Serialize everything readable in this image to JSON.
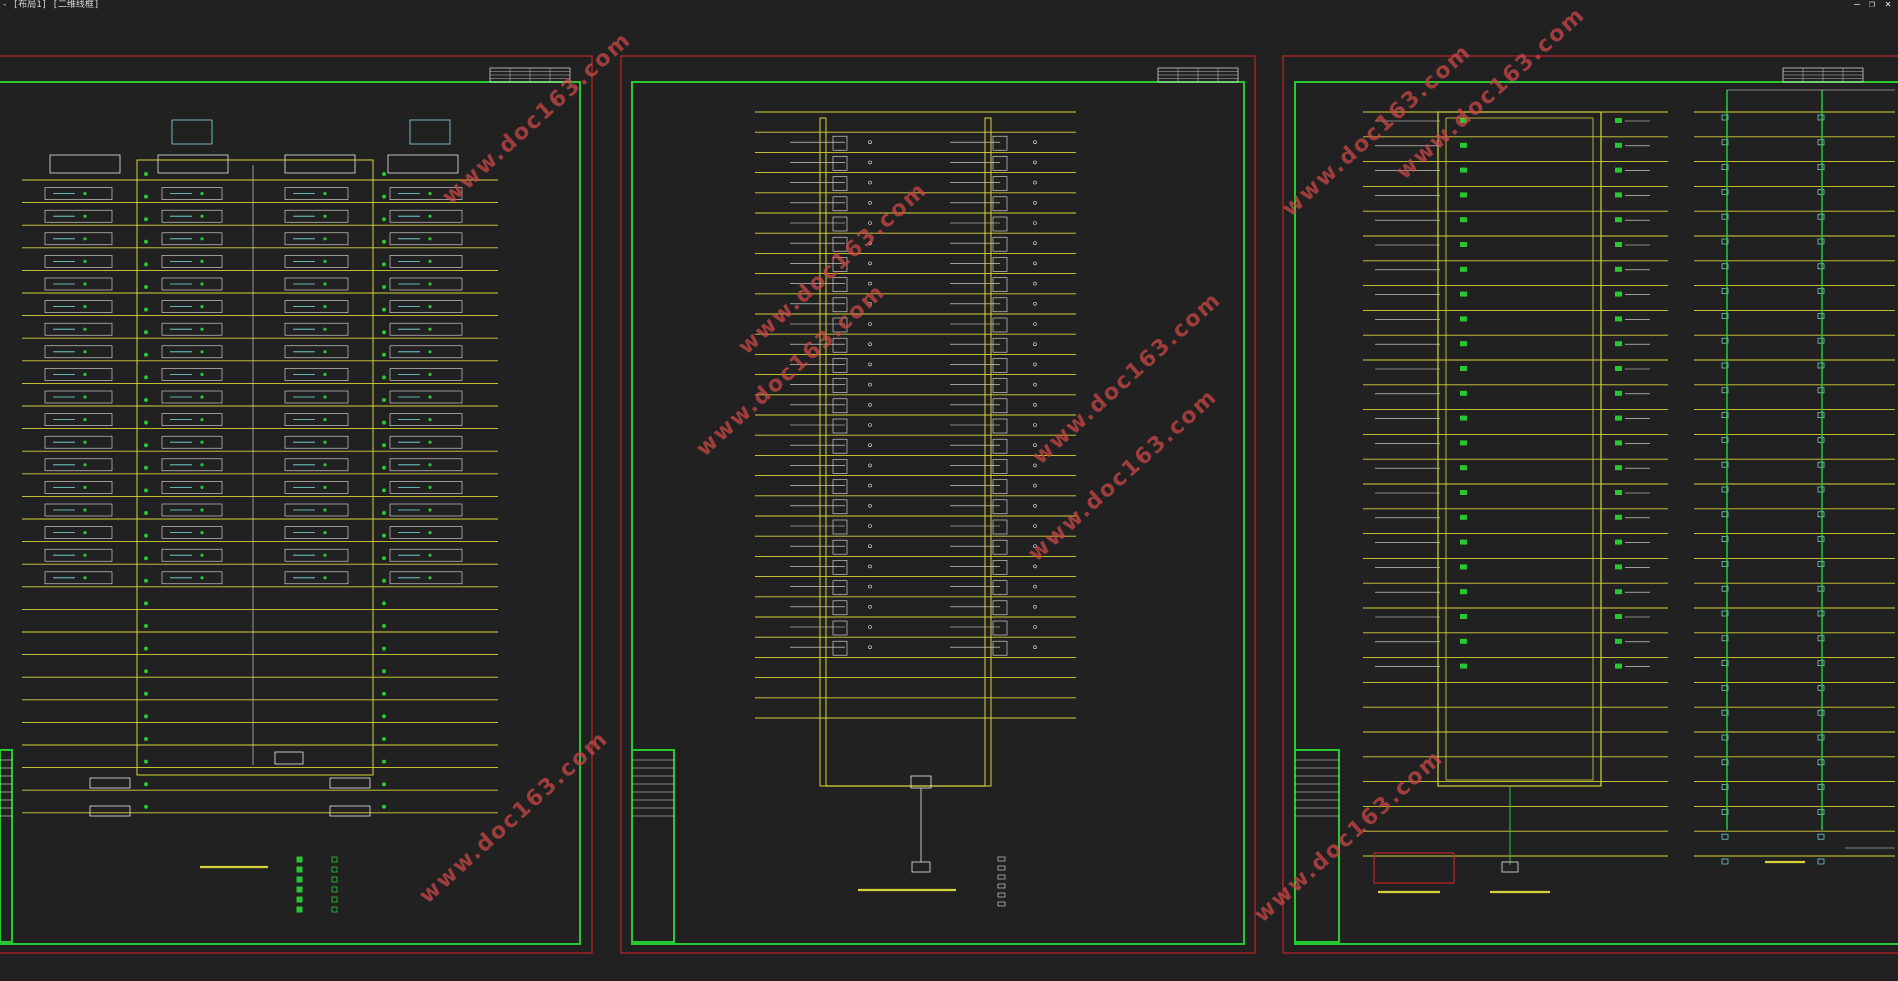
{
  "app": {
    "title": "- [布局1] [二维线框]",
    "controls": {
      "minimize": "–",
      "restore": "❐",
      "close": "✕"
    }
  },
  "colors": {
    "background": "#212121",
    "sheet_border": "#c0242b",
    "frame": "#28c832",
    "wiring": "#d6d23a",
    "device": "#7de3e3",
    "text": "#e6e6e6",
    "watermark": "#d04848"
  },
  "watermarks": [
    "www.doc163.com",
    "www.doc163.com",
    "www.doc163.com",
    "www.doc163.com",
    "www.doc163.com",
    "www.doc163.com",
    "www.doc163.com",
    "www.doc163.com",
    "www.doc163.com"
  ],
  "sheets": [
    {
      "name": "sheet-1",
      "floors": 29
    },
    {
      "name": "sheet-2",
      "floors": 31
    },
    {
      "name": "sheet-3",
      "floors": 31
    }
  ]
}
